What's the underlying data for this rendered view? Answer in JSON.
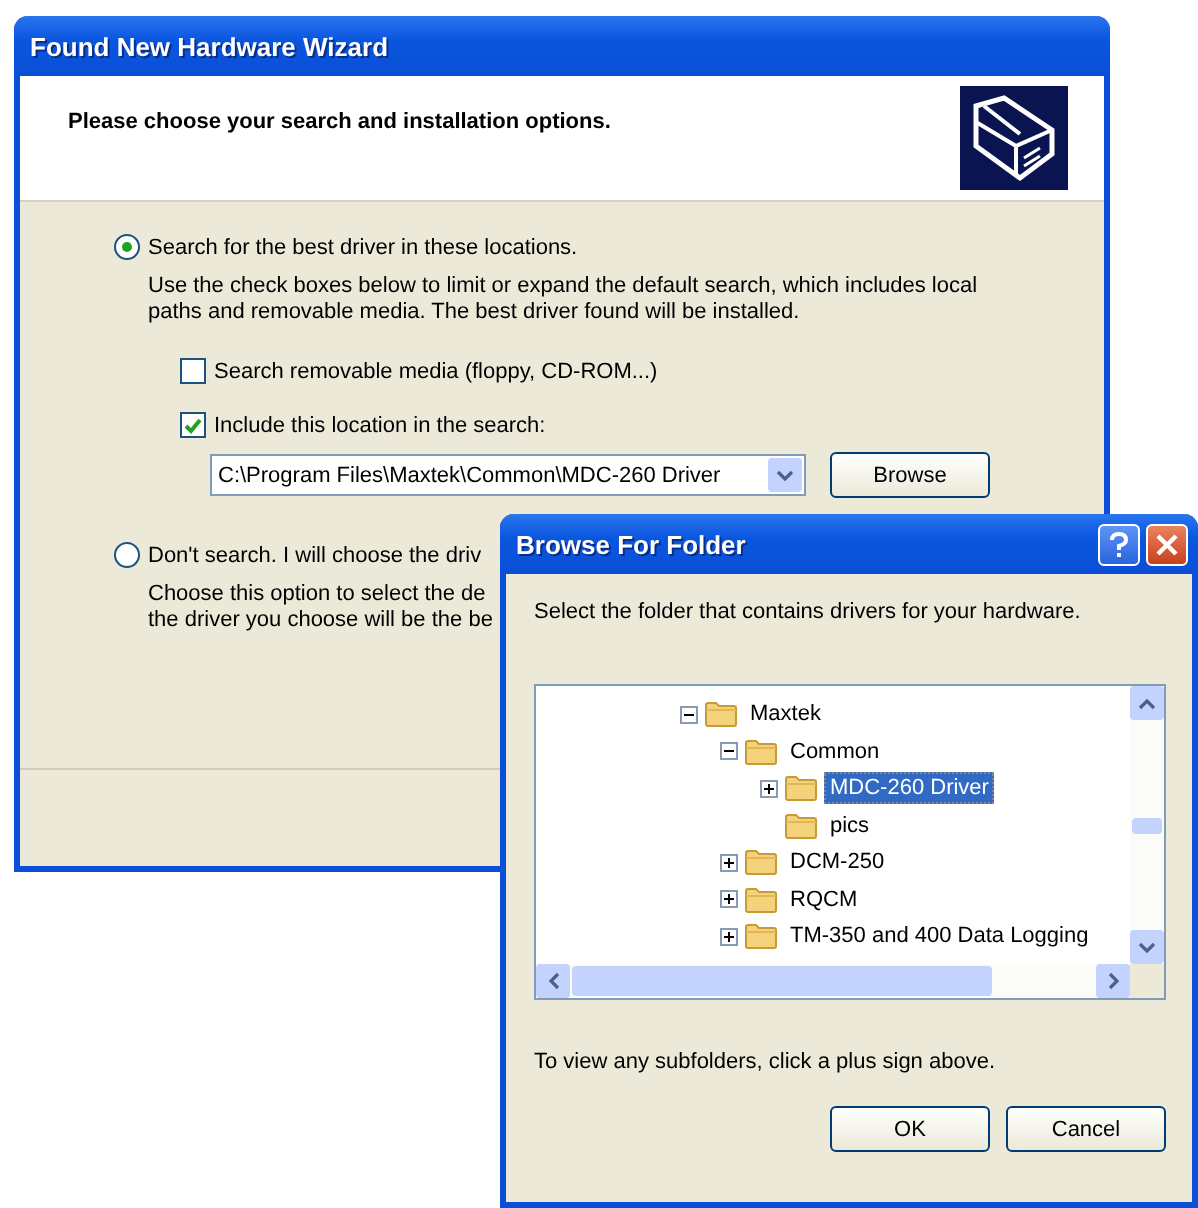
{
  "wizard": {
    "title": "Found New Hardware Wizard",
    "heading": "Please choose your search and installation options.",
    "options": [
      {
        "label": "Search for the best driver in these locations.",
        "selected": true,
        "description": [
          "Use the check boxes below to limit or expand the default search, which includes local",
          "paths and removable media. The best driver found will be installed."
        ]
      },
      {
        "label": "Don't search. I will choose the driv",
        "selected": false,
        "description": [
          "Choose this option to select the de",
          "the driver you choose will be the be"
        ]
      }
    ],
    "checkboxes": [
      {
        "label": "Search removable media (floppy, CD-ROM...)",
        "checked": false
      },
      {
        "label": "Include this location in the search:",
        "checked": true
      }
    ],
    "location": {
      "value": "C:\\Program Files\\Maxtek\\Common\\MDC-260 Driver"
    },
    "browse_button": "Browse"
  },
  "dialog": {
    "title": "Browse For Folder",
    "instruction": "Select the folder that contains drivers for your hardware.",
    "tree": [
      {
        "label": "Maxtek",
        "expandable": true,
        "expanded": true,
        "selected": false,
        "children": [
          {
            "label": "Common",
            "expandable": true,
            "expanded": true,
            "selected": false,
            "children": [
              {
                "label": "MDC-260 Driver",
                "expandable": true,
                "expanded": false,
                "selected": true
              },
              {
                "label": "pics",
                "expandable": false,
                "selected": false
              }
            ]
          },
          {
            "label": "DCM-250",
            "expandable": true,
            "expanded": false,
            "selected": false
          },
          {
            "label": "RQCM",
            "expandable": true,
            "expanded": false,
            "selected": false
          },
          {
            "label": "TM-350 and 400 Data Logging",
            "expandable": true,
            "expanded": false,
            "selected": false
          }
        ]
      }
    ],
    "hint": "To view any subfolders, click a plus sign above.",
    "buttons": [
      "OK",
      "Cancel"
    ]
  }
}
